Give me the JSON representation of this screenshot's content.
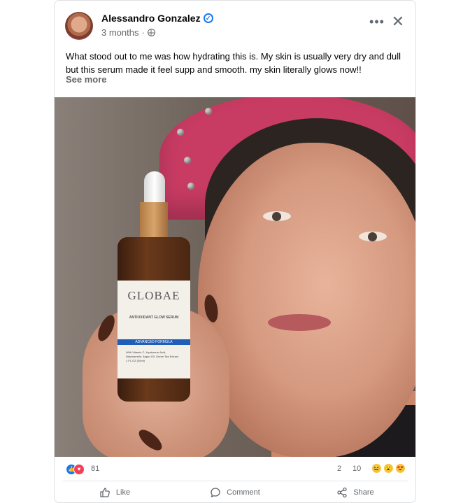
{
  "post": {
    "author": "Alessandro Gonzalez",
    "verified_mark": "✓",
    "time": "3 months",
    "separator": "·",
    "text": "What stood out to me was how hydrating this is. My skin is usually very dry and dull but this serum made it feel supp and smooth. my skin literally glows now!!",
    "see_more": "See more"
  },
  "header": {
    "more_label": "•••",
    "close_label": "✕"
  },
  "product_label": {
    "brand": "GLOBAE",
    "subtitle": "ANTIOXIDANT GLOW SERUM",
    "band": "ADVANCED FORMULA",
    "ingredients": "With Vitamin C, Hyaluronic Acid, Niacinamide, Argan Oil, Green Tea Extract",
    "size": "1 FL OZ (30ml)"
  },
  "stats": {
    "reactions": "81",
    "comments": "2",
    "shares": "10"
  },
  "actions": {
    "like": "Like",
    "comment": "Comment",
    "share": "Share"
  },
  "colors": {
    "accent": "#1877f2",
    "love": "#f33e58",
    "secondary_text": "#65676b"
  },
  "icons": [
    "globe-icon",
    "verified-icon",
    "more-icon",
    "close-icon",
    "like-icon",
    "comment-icon",
    "share-icon"
  ]
}
